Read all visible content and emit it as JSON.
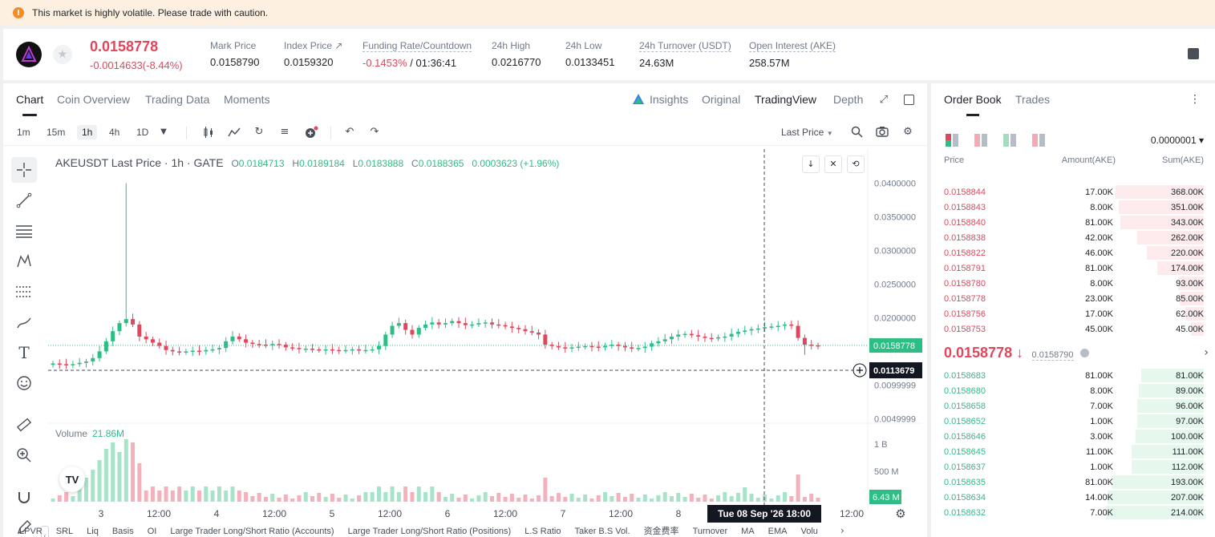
{
  "banner": {
    "message": "This market is highly volatile. Please trade with caution."
  },
  "ticker": {
    "last_price": "0.0158778",
    "change": "-0.0014633(-8.44%)",
    "stats": [
      {
        "label": "Mark Price",
        "value": "0.0158790"
      },
      {
        "label": "Index Price ↗",
        "value": "0.0159320"
      },
      {
        "label": "Funding Rate/Countdown",
        "value_neg": "-0.1453%",
        "value": " / 01:36:41"
      },
      {
        "label": "24h High",
        "value": "0.0216770"
      },
      {
        "label": "24h Low",
        "value": "0.0133451"
      },
      {
        "label": "24h Turnover (USDT)",
        "value": "24.63M"
      },
      {
        "label": "Open Interest (AKE)",
        "value": "258.57M"
      }
    ]
  },
  "chart_tabs": [
    "Chart",
    "Coin Overview",
    "Trading Data",
    "Moments"
  ],
  "view_tabs": [
    "Insights",
    "Original",
    "TradingView",
    "Depth"
  ],
  "intervals": [
    "1m",
    "15m",
    "1h",
    "4h",
    "1D"
  ],
  "price_source": "Last Price",
  "legend": {
    "symbol": "AKEUSDT Last Price · 1h · GATE",
    "o_label": "O",
    "o": "0.0184713",
    "h_label": "H",
    "h": "0.0189184",
    "l_label": "L",
    "l": "0.0183888",
    "c_label": "C",
    "c": "0.0188365",
    "chg": "0.0003623 (+1.96%)"
  },
  "volume_legend": {
    "label": "Volume",
    "value": "21.86M"
  },
  "chart_data": {
    "type": "candlestick",
    "price_axis_ticks": [
      "0.0400000",
      "0.0350000",
      "0.0300000",
      "0.0250000",
      "0.0200000",
      "0.0099999",
      "0.0049999"
    ],
    "volume_axis_ticks": [
      "1 B",
      "500 M"
    ],
    "x_ticks": [
      "3",
      "12:00",
      "4",
      "12:00",
      "5",
      "12:00",
      "6",
      "12:00",
      "7",
      "12:00",
      "8",
      "12:00"
    ],
    "current_price_label": "0.0158778",
    "crosshair_price_label": "0.0113679",
    "crosshair_time_label": "Tue 08 Sep '26   18:00",
    "volume_value_label": "6.43 M",
    "close_path": [
      0.0132,
      0.0131,
      0.013,
      0.0131,
      0.0133,
      0.0135,
      0.014,
      0.015,
      0.0165,
      0.018,
      0.0192,
      0.0198,
      0.019,
      0.0172,
      0.0168,
      0.0163,
      0.0158,
      0.0152,
      0.015,
      0.0149,
      0.015,
      0.0151,
      0.015,
      0.0152,
      0.0153,
      0.0155,
      0.0165,
      0.0172,
      0.0168,
      0.0163,
      0.0161,
      0.016,
      0.0159,
      0.0161,
      0.016,
      0.0156,
      0.0155,
      0.0154,
      0.0154,
      0.0153,
      0.0152,
      0.0153,
      0.0152,
      0.0151,
      0.0152,
      0.0153,
      0.0152,
      0.0152,
      0.0153,
      0.0158,
      0.0175,
      0.0188,
      0.0192,
      0.0182,
      0.0175,
      0.0185,
      0.019,
      0.0193,
      0.019,
      0.0192,
      0.0195,
      0.0192,
      0.0189,
      0.019,
      0.0192,
      0.0193,
      0.019,
      0.0189,
      0.0187,
      0.0185,
      0.0183,
      0.018,
      0.0178,
      0.0175,
      0.016,
      0.0158,
      0.0156,
      0.0155,
      0.0156,
      0.0157,
      0.0158,
      0.0157,
      0.0156,
      0.0158,
      0.016,
      0.0158,
      0.0156,
      0.0154,
      0.0155,
      0.0157,
      0.0162,
      0.0165,
      0.0168,
      0.0172,
      0.0175,
      0.0176,
      0.0174,
      0.0172,
      0.017,
      0.0169,
      0.0171,
      0.0172,
      0.0176,
      0.0179,
      0.0181,
      0.0183,
      0.0184,
      0.0186,
      0.0187,
      0.0188,
      0.019,
      0.0188,
      0.017,
      0.016,
      0.0159,
      0.0158
    ]
  },
  "ob": {
    "tabs": [
      "Order Book",
      "Trades"
    ],
    "precision": "0.0000001 ▾",
    "headers": [
      "Price",
      "Amount(AKE)",
      "Sum(AKE)"
    ],
    "asks": [
      {
        "p": "0.0158844",
        "a": "17.00K",
        "s": "368.00K",
        "w": 0.48
      },
      {
        "p": "0.0158843",
        "a": "8.00K",
        "s": "351.00K",
        "w": 0.46
      },
      {
        "p": "0.0158840",
        "a": "81.00K",
        "s": "343.00K",
        "w": 0.45
      },
      {
        "p": "0.0158838",
        "a": "42.00K",
        "s": "262.00K",
        "w": 0.36
      },
      {
        "p": "0.0158822",
        "a": "46.00K",
        "s": "220.00K",
        "w": 0.31
      },
      {
        "p": "0.0158791",
        "a": "81.00K",
        "s": "174.00K",
        "w": 0.25
      },
      {
        "p": "0.0158780",
        "a": "8.00K",
        "s": "93.00K",
        "w": 0.14
      },
      {
        "p": "0.0158778",
        "a": "23.00K",
        "s": "85.00K",
        "w": 0.13
      },
      {
        "p": "0.0158756",
        "a": "17.00K",
        "s": "62.00K",
        "w": 0.1
      },
      {
        "p": "0.0158753",
        "a": "45.00K",
        "s": "45.00K",
        "w": 0.07
      }
    ],
    "mid": {
      "price": "0.0158778 ↓",
      "mark": "0.0158790"
    },
    "bids": [
      {
        "p": "0.0158683",
        "a": "81.00K",
        "s": "81.00K",
        "w": 0.34
      },
      {
        "p": "0.0158680",
        "a": "8.00K",
        "s": "89.00K",
        "w": 0.35
      },
      {
        "p": "0.0158658",
        "a": "7.00K",
        "s": "96.00K",
        "w": 0.36
      },
      {
        "p": "0.0158652",
        "a": "1.00K",
        "s": "97.00K",
        "w": 0.36
      },
      {
        "p": "0.0158646",
        "a": "3.00K",
        "s": "100.00K",
        "w": 0.37
      },
      {
        "p": "0.0158645",
        "a": "11.00K",
        "s": "111.00K",
        "w": 0.39
      },
      {
        "p": "0.0158637",
        "a": "1.00K",
        "s": "112.00K",
        "w": 0.39
      },
      {
        "p": "0.0158635",
        "a": "81.00K",
        "s": "193.00K",
        "w": 0.5
      },
      {
        "p": "0.0158634",
        "a": "14.00K",
        "s": "207.00K",
        "w": 0.52
      },
      {
        "p": "0.0158632",
        "a": "7.00K",
        "s": "214.00K",
        "w": 0.53
      }
    ]
  },
  "bottom_indicators": [
    "LPVR",
    "SRL",
    "Liq",
    "Basis",
    "OI",
    "Large Trader Long/Short Ratio (Accounts)",
    "Large Trader Long/Short Ratio (Positions)",
    "L.S Ratio",
    "Taker B.S Vol.",
    "资金费率",
    "Turnover",
    "MA",
    "EMA",
    "Volu"
  ],
  "colors": {
    "up": "#2ebd85",
    "down": "#e0475c",
    "text": "#1e2329",
    "muted": "#707a8a",
    "ask_bg": "#fdeaec",
    "bid_bg": "#e6f7ee"
  }
}
